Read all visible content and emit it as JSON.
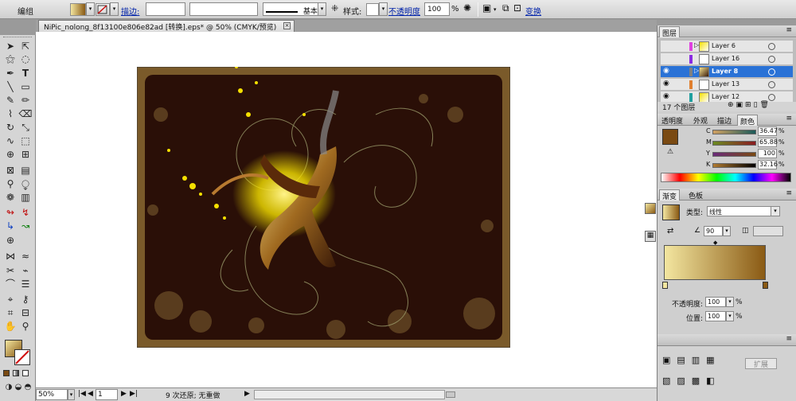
{
  "control_bar": {
    "mode": "编组",
    "stroke_label": "描边:",
    "stroke_style": "基本",
    "style_label": "样式:",
    "opacity_label": "不透明度",
    "opacity_value": "100",
    "opacity_unit": "%",
    "transform_label": "变换"
  },
  "document_tab": {
    "title": "NiPic_nolong_8f13100e806e82ad  [转换].eps* @ 50% (CMYK/预览)",
    "close": "×"
  },
  "status_bar": {
    "zoom": "50%",
    "artboard": "1",
    "undo_text": "9 次还原; 无重做"
  },
  "layers_panel": {
    "title": "图层",
    "layers": [
      {
        "name": "Layer 6",
        "color": "#e040e0",
        "visible": false,
        "selected": false
      },
      {
        "name": "Layer 16",
        "color": "#8a2be2",
        "visible": false,
        "selected": false
      },
      {
        "name": "Layer 8",
        "color": "#808080",
        "visible": true,
        "selected": true
      },
      {
        "name": "Layer 13",
        "color": "#e08030",
        "visible": true,
        "selected": false
      },
      {
        "name": "Layer 12",
        "color": "#20a0a0",
        "visible": true,
        "selected": false
      }
    ],
    "count_label": "17 个图层"
  },
  "color_panel": {
    "tabs": [
      "透明度",
      "外观",
      "描边",
      "颜色"
    ],
    "active_tab": "颜色",
    "fill_color": "#7a4a12",
    "channels": [
      {
        "name": "C",
        "value": "36.47",
        "unit": "%"
      },
      {
        "name": "M",
        "value": "65.88",
        "unit": "%"
      },
      {
        "name": "Y",
        "value": "100",
        "unit": "%"
      },
      {
        "name": "K",
        "value": "32.16",
        "unit": "%"
      }
    ]
  },
  "gradient_panel": {
    "tabs": [
      "渐变",
      "色板"
    ],
    "active_tab": "渐变",
    "type_label": "类型:",
    "type_value": "线性",
    "angle_value": "90",
    "opacity_label": "不透明度:",
    "opacity_value": "100",
    "opacity_unit": "%",
    "location_label": "位置:",
    "location_value": "100",
    "location_unit": "%",
    "start_color": "#f3e6a0",
    "end_color": "#8a5a14"
  },
  "bottom_panel": {
    "expand_label": "扩展"
  },
  "colors": {
    "artwork_bg": "#2a0f07",
    "artwork_frame": "#7a5a2a",
    "accent_yellow": "#f5e000"
  },
  "icons": [
    "selection-tool-icon",
    "direct-selection-icon",
    "magic-wand-icon",
    "lasso-icon",
    "pen-icon",
    "type-icon",
    "line-icon",
    "rectangle-icon",
    "paintbrush-icon",
    "pencil-icon",
    "rotate-icon",
    "scale-icon",
    "warp-icon",
    "free-transform-icon",
    "symbol-sprayer-icon",
    "column-graph-icon",
    "mesh-icon",
    "gradient-icon",
    "eyedropper-icon",
    "blend-icon",
    "live-paint-icon",
    "slice-icon",
    "eraser-icon",
    "scissors-icon",
    "hand-icon",
    "zoom-icon"
  ]
}
